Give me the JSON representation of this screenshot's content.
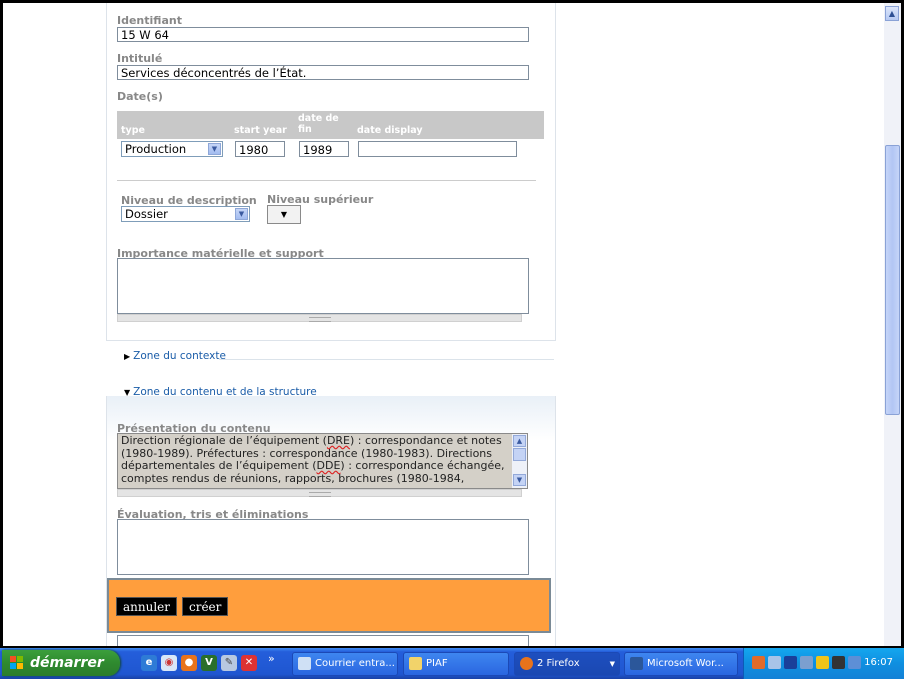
{
  "form": {
    "identifiant": {
      "label": "Identifiant",
      "value": "15 W 64"
    },
    "intitule": {
      "label": "Intitulé",
      "value": "Services déconcentrés de l’État."
    },
    "dates": {
      "label": "Date(s)",
      "columns": {
        "type": "type",
        "start_year": "start year",
        "end_line1": "date de",
        "end_line2": "fin",
        "display": "date display"
      },
      "row": {
        "type": "Production",
        "start_year": "1980",
        "end_year": "1989",
        "display": ""
      }
    },
    "niveau_description": {
      "label": "Niveau de description",
      "value": "Dossier"
    },
    "niveau_superieur": {
      "label": "Niveau supérieur"
    },
    "importance": {
      "label": "Importance matérielle et support",
      "value": ""
    }
  },
  "zones": {
    "contexte": "Zone du contexte",
    "contenu": "Zone du contenu et de la structure"
  },
  "contenu": {
    "presentation_label": "Présentation du contenu",
    "presentation_text": {
      "p1": "Direction régionale de l’équipement (",
      "abbr1": "DRE",
      "p2": ") : correspondance et notes (1980-1989). Préfectures : correspondance (1980-1983). Directions départementales de l’équipement (",
      "abbr2": "DDE",
      "p3": ") : correspondance échangée, comptes rendus de réunions, rapports, brochures (1980-1984,"
    },
    "evaluation_label": "Évaluation, tris et éliminations"
  },
  "actions": {
    "annuler": "annuler",
    "creer": "créer"
  },
  "taskbar": {
    "start_label": "démarrer",
    "tasks": [
      "Courrier entra...",
      "PIAF",
      "2 Firefox",
      "Microsoft Wor..."
    ],
    "clock": "16:07",
    "overflow": "»"
  }
}
